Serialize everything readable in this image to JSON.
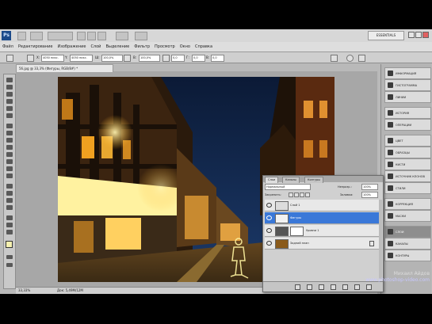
{
  "app": {
    "logo": "Ps",
    "workspace": "ESSENTIALS"
  },
  "menu": [
    "Файл",
    "Редактирование",
    "Изображение",
    "Слой",
    "Выделение",
    "Фильтр",
    "Просмотр",
    "Окно",
    "Справка"
  ],
  "options": {
    "x_value": "4050 пикс.",
    "y_value": "4050 пикс.",
    "w_value": "100,0%",
    "h_value": "100,0%",
    "angle_value": "0,0",
    "hskew_value": "0,0",
    "vskew_value": "0,0"
  },
  "document": {
    "tab_title": "56.jpg @ 33,3% (Фигуры, RGB/8#) *",
    "zoom": "33,33%",
    "status": "Док: 5,49M/12M"
  },
  "dock": {
    "items": [
      "ИНФОРМАЦИЯ",
      "ГИСТОГРАММА",
      "ЛИНИИ",
      "ИСТОРИЯ",
      "ОПЕРАЦИИ",
      "ЦВЕТ",
      "ОБРАЗЦЫ",
      "КИСТИ",
      "ИСТОЧНИК КЛОНОВ",
      "СТИЛИ",
      "КОРРЕКЦИЯ",
      "МАСКИ",
      "СЛОИ",
      "КАНАЛЫ",
      "КОНТУРЫ"
    ],
    "active_index": 12
  },
  "layers_panel": {
    "tabs": [
      "Слои",
      "Каналы",
      "Контуры"
    ],
    "blend_mode": "Нормальный",
    "opacity_label": "Непрозр.:",
    "opacity_value": "100%",
    "lock_label": "Закрепить:",
    "fill_label": "Заливка:",
    "fill_value": "100%",
    "layers": [
      {
        "name": "Слой 1",
        "selected": false,
        "thumb": "#dcdcdc"
      },
      {
        "name": "Фигуры",
        "selected": true,
        "thumb": "#f2f2f2"
      },
      {
        "name": "Уровни 1",
        "selected": false,
        "thumb": "#ffffff"
      },
      {
        "name": "Задний план",
        "selected": false,
        "thumb": "#8a5a1a"
      }
    ]
  },
  "watermark": {
    "author": "Михаил Айдов",
    "site": "www.photoshop-video.com"
  },
  "colors": {
    "selection": "#3a78d8",
    "chrome": "#b9b9b9"
  }
}
